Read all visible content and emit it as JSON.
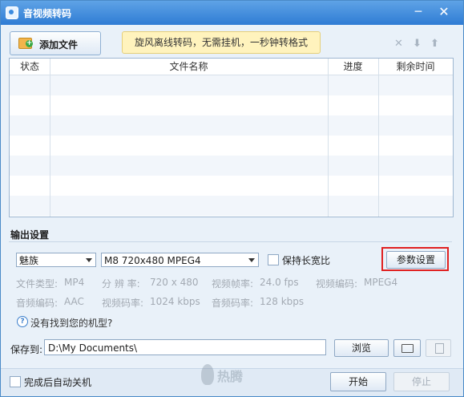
{
  "window": {
    "title": "音视频转码",
    "minimize": "─",
    "close": "✕"
  },
  "toolbar": {
    "add_file_label": "添加文件",
    "add_icon": "add-file-folder-icon",
    "banner": "旋风离线转码，无需挂机，一秒钟转格式",
    "delete_icon": "✕",
    "down_icon": "⬇",
    "up_icon": "⬆"
  },
  "table": {
    "columns": [
      "状态",
      "文件名称",
      "进度",
      "剩余时间"
    ],
    "rows": []
  },
  "output": {
    "section_label": "输出设置",
    "brand_select": "魅族",
    "model_select": "M8 720x480 MPEG4",
    "keep_ratio_label": "保持长宽比",
    "keep_ratio_checked": false,
    "params_button": "参数设置",
    "info": {
      "file_type_label": "文件类型:",
      "file_type": "MP4",
      "resolution_label": "分 辨 率:",
      "resolution": "720 x 480",
      "frame_rate_label": "视频帧率:",
      "frame_rate": "24.0 fps",
      "video_codec_label": "视频编码:",
      "video_codec": "MPEG4",
      "audio_codec_label": "音频编码:",
      "audio_codec": "AAC",
      "video_bitrate_label": "视频码率:",
      "video_bitrate": "1024 kbps",
      "audio_bitrate_label": "音频码率:",
      "audio_bitrate": "128 kbps"
    },
    "help_text": "没有找到您的机型?"
  },
  "save": {
    "label": "保存到:",
    "path": "D:\\My Documents\\",
    "browse_button": "浏览"
  },
  "footer": {
    "shutdown_label": "完成后自动关机",
    "shutdown_checked": false,
    "start_button": "开始",
    "stop_button": "停止",
    "watermark": "热腾"
  },
  "colors": {
    "titlebar": "#2f7cd4",
    "highlight_border": "#e02020",
    "banner_bg": "#fff3bd"
  }
}
